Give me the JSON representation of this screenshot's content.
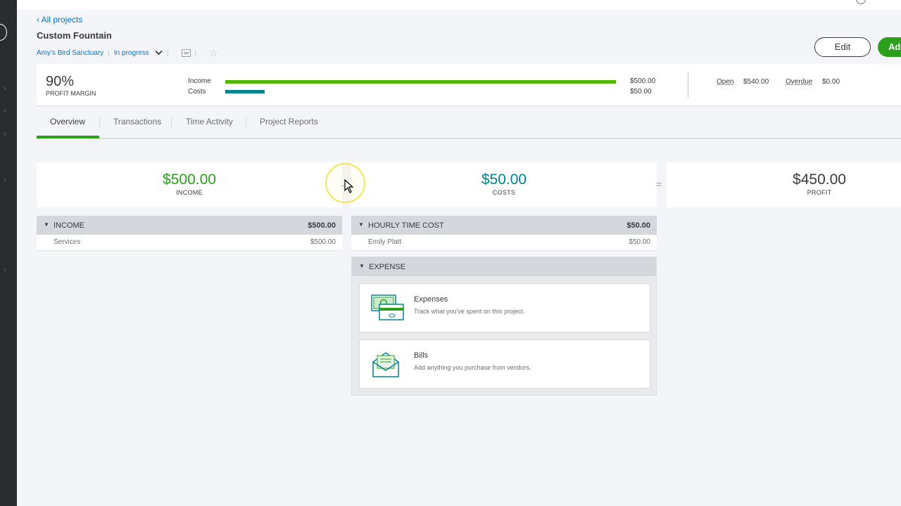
{
  "nav": {
    "back_link": "All projects"
  },
  "project": {
    "title": "Custom Fountain",
    "customer": "Amy's Bird Sanctuary",
    "status": "In progress"
  },
  "actions": {
    "edit_label": "Edit",
    "add_label": "Ad"
  },
  "summary": {
    "profit_margin_value": "90%",
    "profit_margin_label": "PROFIT MARGIN",
    "income_label": "Income",
    "costs_label": "Costs",
    "income_amount": "$500.00",
    "costs_amount": "$50.00",
    "income_bar_fraction": 1.0,
    "costs_bar_fraction": 0.1,
    "open_label": "Open",
    "open_value": "$540.00",
    "overdue_label": "Overdue",
    "overdue_value": "$0.00"
  },
  "tabs": [
    {
      "label": "Overview",
      "active": true
    },
    {
      "label": "Transactions",
      "active": false
    },
    {
      "label": "Time Activity",
      "active": false
    },
    {
      "label": "Project Reports",
      "active": false
    }
  ],
  "kpis": {
    "income": {
      "value": "$500.00",
      "label": "INCOME",
      "color": "#2ca01c"
    },
    "costs": {
      "value": "$50.00",
      "label": "COSTS",
      "color": "#00838f"
    },
    "profit": {
      "value": "$450.00",
      "label": "PROFIT",
      "color": "#393a3d"
    },
    "minus_icon": "minus-operator-icon",
    "equals_icon": "equals-operator-icon"
  },
  "income_section": {
    "title": "INCOME",
    "total": "$500.00",
    "rows": [
      {
        "name": "Services",
        "amount": "$500.00"
      }
    ]
  },
  "hourly_section": {
    "title": "HOURLY TIME COST",
    "total": "$50.00",
    "rows": [
      {
        "name": "Emily Platt",
        "amount": "$50.00"
      }
    ]
  },
  "expense_section": {
    "title": "EXPENSE",
    "cards": [
      {
        "title": "Expenses",
        "description": "Track what you've spent on this project.",
        "icon": "money-cards-icon"
      },
      {
        "title": "Bills",
        "description": "Add anything you purchase from vendors.",
        "icon": "envelope-bill-icon"
      }
    ]
  },
  "colors": {
    "brand_green": "#2ca01c",
    "teal": "#00838f",
    "link_blue": "#0077c5"
  }
}
